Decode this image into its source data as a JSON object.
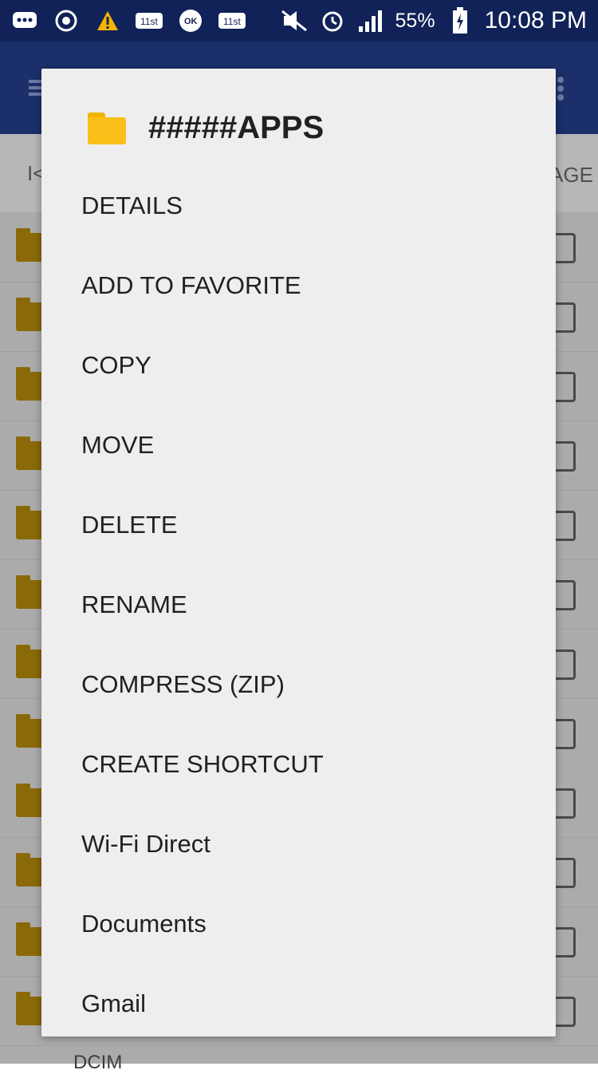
{
  "status_bar": {
    "battery": "55%",
    "time": "10:08 PM",
    "icons": [
      "chat-icon",
      "sync-icon",
      "warning-icon",
      "11st-icon",
      "ok-cashbag-icon",
      "11st-icon",
      "mute-icon",
      "alarm-icon",
      "signal-icon",
      "battery-icon"
    ]
  },
  "tabs": {
    "left_fragment": "I<",
    "right_fragment": "AGE"
  },
  "background_list": {
    "rows": 12,
    "bottom_partial_text": "DCIM"
  },
  "dialog": {
    "title": "#####APPS",
    "folder_color": "#fbbf1a",
    "items": [
      {
        "label": "DETAILS"
      },
      {
        "label": "ADD TO FAVORITE"
      },
      {
        "label": "COPY"
      },
      {
        "label": "MOVE"
      },
      {
        "label": "DELETE"
      },
      {
        "label": "RENAME"
      },
      {
        "label": "COMPRESS (ZIP)"
      },
      {
        "label": "CREATE SHORTCUT"
      },
      {
        "label": "Wi-Fi Direct"
      },
      {
        "label": "Documents"
      },
      {
        "label": "Gmail"
      }
    ]
  },
  "colors": {
    "status_bar": "#102257",
    "app_bar": "#1b2f6b",
    "dialog_bg": "#eeeeee"
  }
}
